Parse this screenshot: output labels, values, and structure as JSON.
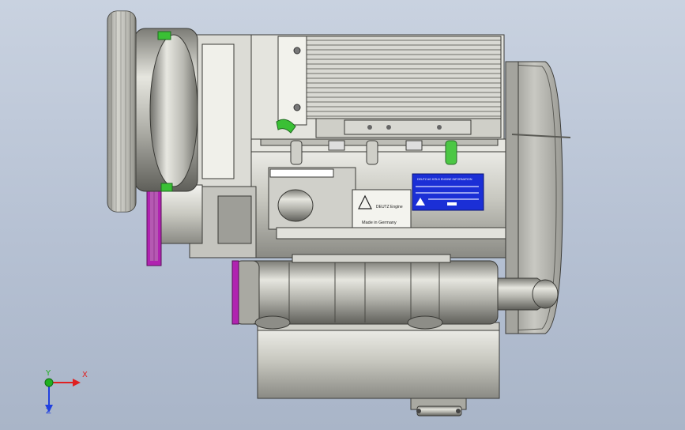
{
  "viewport": {
    "background_top": "#c9d2e0",
    "background_bottom": "#a9b5c8"
  },
  "model": {
    "nameplate": {
      "header": "DEUTZ AG KÖLN ENGINE INFORMATION",
      "color": "#1b2fd6"
    },
    "brand_text": "DEUTZ Engine",
    "origin_text": "Made in Germany",
    "accent_green": "#2fbf2a",
    "accent_magenta": "#b023b0"
  },
  "triad": {
    "x_label": "X",
    "y_label": "Y",
    "z_label": "Z",
    "x_color": "#e02020",
    "y_color": "#20b020",
    "z_color": "#2040e0"
  }
}
